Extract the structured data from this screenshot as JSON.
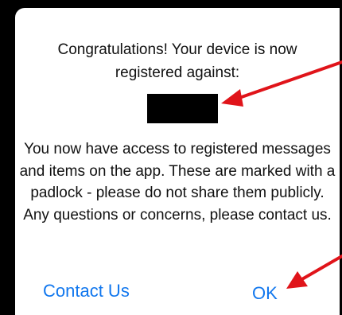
{
  "dialog": {
    "title": "Congratulations! Your device is now registered against:",
    "redacted_label": "",
    "message": "You now have access to registered messages and items on the app. These are marked with a padlock - please do not share them publicly.  Any questions or concerns, please contact us."
  },
  "buttons": {
    "contact_label": "Contact Us",
    "ok_label": "OK"
  },
  "colors": {
    "button_text": "#1177ee",
    "annotation_arrow": "#e0141a",
    "redaction_box": "#000000"
  }
}
